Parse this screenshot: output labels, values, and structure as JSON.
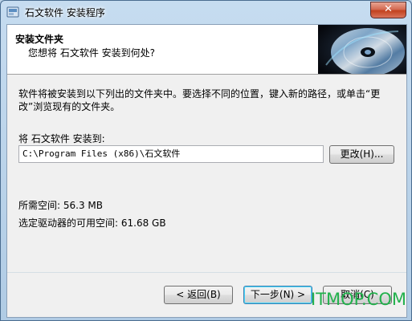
{
  "window": {
    "title": "石文软件 安装程序",
    "close_label": "✕"
  },
  "header": {
    "title": "安装文件夹",
    "subtitle": "您想将 石文软件 安装到何处?"
  },
  "content": {
    "description": "软件将被安装到以下列出的文件夹中。要选择不同的位置，键入新的路径，或单击“更改”浏览现有的文件夹。",
    "install_label": "将 石文软件 安装到:",
    "path_value": "C:\\Program Files (x86)\\石文软件",
    "browse_label": "更改(H)...",
    "required_space": "所需空间: 56.3 MB",
    "available_space": "选定驱动器的可用空间: 61.68 GB"
  },
  "buttons": {
    "back": "< 返回(B)",
    "next": "下一步(N) >",
    "cancel": "取消(C)"
  },
  "watermark": "ITMOP.COM",
  "colors": {
    "titlebar": "#bcd3e8",
    "watermark": "#22b14c",
    "close": "#c2421f"
  }
}
